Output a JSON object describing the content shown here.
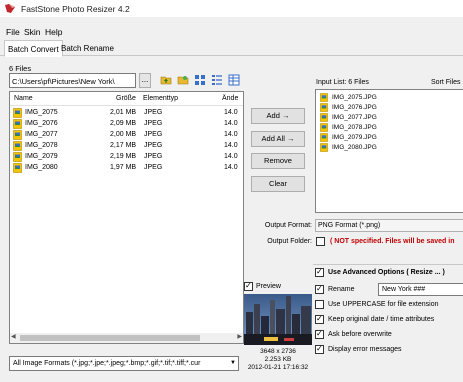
{
  "window": {
    "title": "FastStone Photo Resizer 4.2"
  },
  "menu": [
    "File",
    "Skin",
    "Help"
  ],
  "tabs": [
    {
      "label": "Batch Convert",
      "active": true
    },
    {
      "label": "Batch Rename",
      "active": false
    }
  ],
  "files_count": "6 Files",
  "path": {
    "value": "C:\\Users\\pf\\Pictures\\New York\\",
    "browse_label": "..."
  },
  "toolbar_icons": [
    "folder-up-icon",
    "new-folder-icon",
    "thumbnails-view-icon",
    "details-view-icon",
    "list-view-icon"
  ],
  "file_list": {
    "columns": [
      "Name",
      "Größe",
      "Elementtyp",
      "Ände"
    ],
    "rows": [
      {
        "name": "IMG_2075",
        "size": "2,01 MB",
        "type": "JPEG",
        "date": "14.0"
      },
      {
        "name": "IMG_2076",
        "size": "2,09 MB",
        "type": "JPEG",
        "date": "14.0"
      },
      {
        "name": "IMG_2077",
        "size": "2,00 MB",
        "type": "JPEG",
        "date": "14.0"
      },
      {
        "name": "IMG_2078",
        "size": "2,17 MB",
        "type": "JPEG",
        "date": "14.0"
      },
      {
        "name": "IMG_2079",
        "size": "2,19 MB",
        "type": "JPEG",
        "date": "14.0"
      },
      {
        "name": "IMG_2080",
        "size": "1,97 MB",
        "type": "JPEG",
        "date": "14.0"
      }
    ]
  },
  "filter": {
    "value": "All Image Formats (*.jpg;*.jpe;*.jpeg;*.bmp;*.gif;*.tif;*.tiff;*.cur"
  },
  "buttons": {
    "add": "Add  →",
    "add_all": "Add All  →",
    "remove": "Remove",
    "clear": "Clear"
  },
  "input_list": {
    "label": "Input List: 6 Files",
    "sort_label": "Sort Files",
    "files": [
      "IMG_2075.JPG",
      "IMG_2076.JPG",
      "IMG_2077.JPG",
      "IMG_2078.JPG",
      "IMG_2079.JPG",
      "IMG_2080.JPG"
    ]
  },
  "output": {
    "format_label": "Output Format:",
    "format_value": "PNG Format (*.png)",
    "folder_label": "Output Folder:",
    "folder_warning": "( NOT specified.  Files will be saved in"
  },
  "preview": {
    "label": "Preview",
    "checked": true,
    "dimensions": "3648 x 2736",
    "filesize": "2.253 KB",
    "datetime": "2012-01-21 17:16:32"
  },
  "options": {
    "advanced": {
      "label": "Use Advanced Options ( Resize ... )",
      "checked": true
    },
    "rename": {
      "label": "Rename",
      "checked": true,
      "value": "New York ###"
    },
    "uppercase": {
      "label": "Use UPPERCASE for file extension",
      "checked": false
    },
    "keep_date": {
      "label": "Keep original date / time attributes",
      "checked": true
    },
    "ask_overwrite": {
      "label": "Ask before overwrite",
      "checked": true
    },
    "display_errors": {
      "label": "Display error messages",
      "checked": true
    }
  },
  "colors": {
    "warning": "#c00000",
    "folder_yellow": "#f5c400"
  }
}
